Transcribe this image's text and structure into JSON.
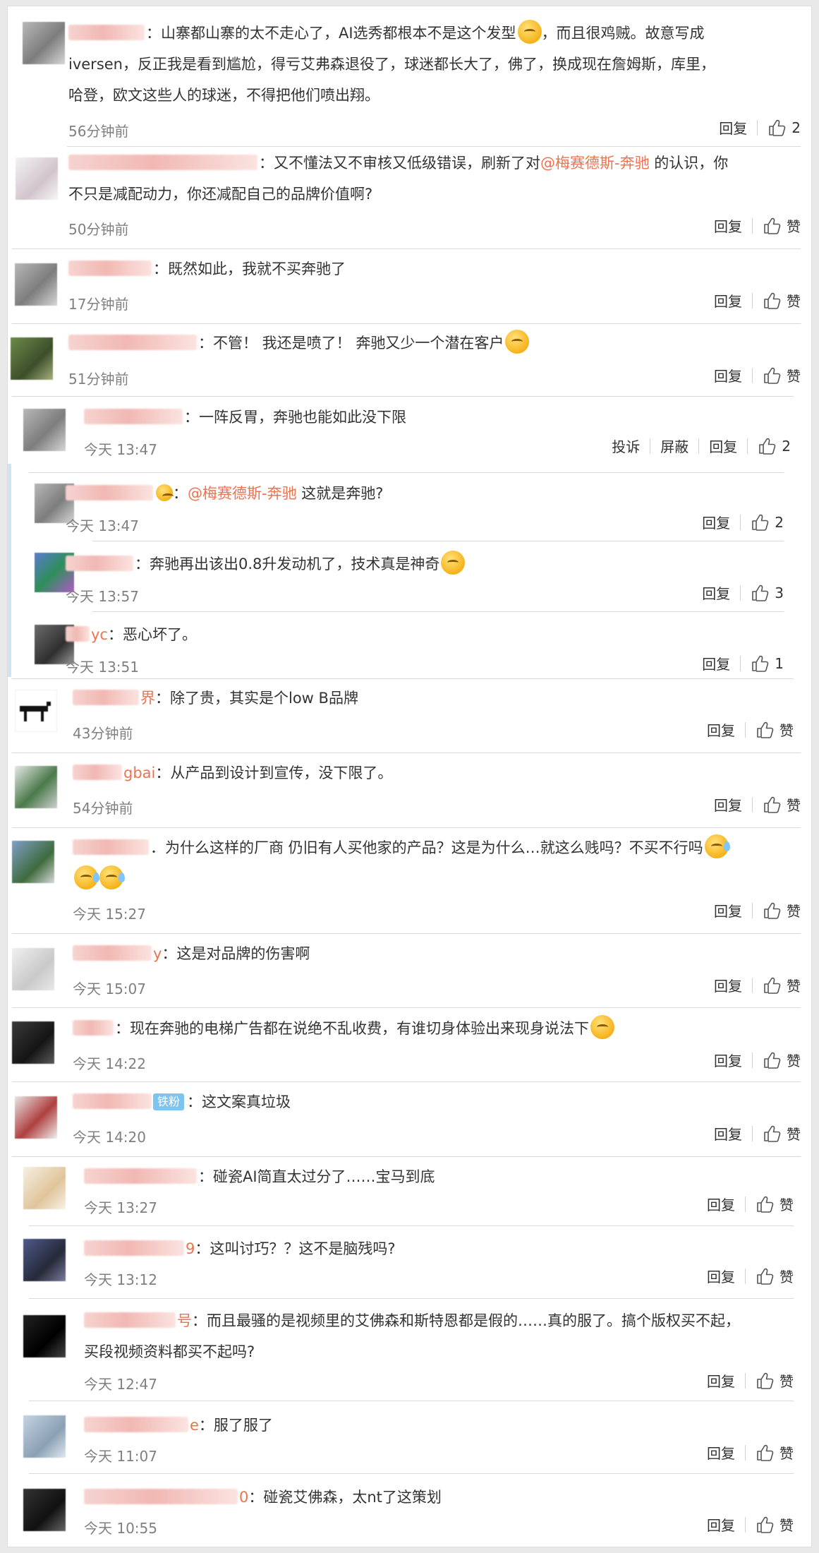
{
  "ui": {
    "reply": "回复",
    "like": "赞",
    "report": "投诉",
    "block": "屏蔽",
    "accent_color": "#eb7350",
    "badge_color": "#7ec4f1"
  },
  "comments": [
    {
      "name": "",
      "text_1": "：山寨都山寨的太不走心了，AI选秀都根本不是这个发型",
      "text_2": "，而且很鸡贼。故意写成",
      "line2": "iversen，反正我是看到尴尬，得亏艾弗森退役了，球迷都长大了，佛了，换成现在詹姆斯，库里，",
      "line3": "哈登，欧文这些人的球迷，不得把他们喷出翔。",
      "time": "56分钟前",
      "likes": "2"
    },
    {
      "name": "",
      "text_1": "：又不懂法又不审核又低级错误，刷新了对",
      "mention": "@梅赛德斯-奔驰",
      "text_2": " 的认识，你",
      "line2": "不只是减配动力，你还减配自己的品牌价值啊?",
      "time": "50分钟前"
    },
    {
      "name": "",
      "text_1": "：既然如此，我就不买奔驰了",
      "time": "17分钟前"
    },
    {
      "name": "",
      "text_1": "：不管！ 我还是喷了！ 奔驰又少一个潜在客户",
      "time": "51分钟前"
    },
    {
      "name": "",
      "text_1": "：一阵反胃，奔驰也能如此没下限",
      "time": "今天 13:47",
      "likes": "2"
    },
    {
      "name": "",
      "text_1": "：",
      "mention": "@梅赛德斯-奔驰",
      "text_2": " 这就是奔驰?",
      "time": "今天 13:47",
      "likes": "2"
    },
    {
      "name": "",
      "text_1": "：奔驰再出该出0.8升发动机了，技术真是神奇",
      "time": "今天 13:57",
      "likes": "3"
    },
    {
      "name": "yc",
      "text_1": "：恶心坏了。",
      "time": "今天 13:51",
      "likes": "1"
    },
    {
      "name": "界",
      "text_1": "：除了贵，其实是个low B品牌",
      "time": "43分钟前"
    },
    {
      "name": "gbai",
      "text_1": "：从产品到设计到宣传，没下限了。",
      "time": "54分钟前"
    },
    {
      "name": "",
      "text_1": "．为什么这样的厂商 仍旧有人买他家的产品？这是为什么…就这么贱吗？不买不行吗",
      "time": "今天 15:27"
    },
    {
      "name": "y",
      "text_1": "：这是对品牌的伤害啊",
      "time": "今天 15:07"
    },
    {
      "name": "",
      "text_1": "：现在奔驰的电梯广告都在说绝不乱收费，有谁切身体验出来现身说法下",
      "time": "今天 14:22"
    },
    {
      "name": "",
      "badge": "铁粉",
      "text_1": "：这文案真垃圾",
      "time": "今天 14:20"
    },
    {
      "name": "",
      "text_1": "：碰瓷AI简直太过分了……宝马到底",
      "time": "今天 13:27"
    },
    {
      "name": "9",
      "text_1": "：这叫讨巧？？这不是脑残吗?",
      "time": "今天 13:12"
    },
    {
      "name": "号",
      "text_1": "：而且最骚的是视频里的艾佛森和斯特恩都是假的……真的服了。搞个版权买不起，",
      "line2": "买段视频资料都买不起吗?",
      "time": "今天 12:47"
    },
    {
      "name": "e",
      "text_1": "：服了服了",
      "time": "今天 11:07"
    },
    {
      "name": "0",
      "text_1": "：碰瓷艾佛森，太nt了这策划",
      "time": "今天 10:55"
    }
  ]
}
